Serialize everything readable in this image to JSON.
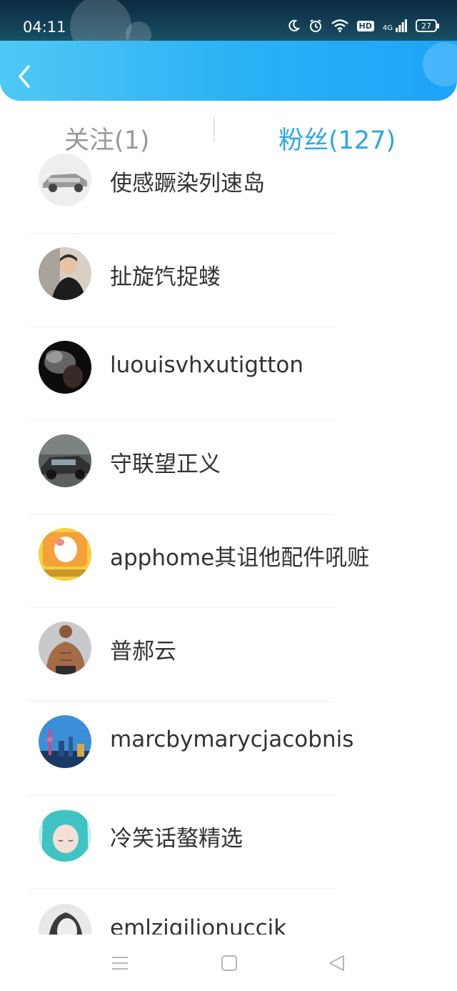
{
  "status_bar": {
    "time": "04:11",
    "icons": [
      "moon-icon",
      "alarm-icon",
      "wifi-icon",
      "hd-icon",
      "signal-4g-icon",
      "battery-icon"
    ],
    "hd_label": "HD",
    "network_label": "4G",
    "battery_level": "27"
  },
  "header": {
    "back_icon": "chevron-left-icon",
    "accent_colors": [
      "#4fc8f5",
      "#1ea4f8"
    ]
  },
  "tabs": [
    {
      "label": "关注(1)",
      "active": false
    },
    {
      "label": "粉丝(127)",
      "active": true
    }
  ],
  "tab_active_color": "#2ba8e6",
  "fans": [
    {
      "name": "使感蹶染列速岛",
      "avatar": "car-avatar"
    },
    {
      "name": "扯旋饩捉蝼",
      "avatar": "boy-avatar"
    },
    {
      "name": "luouisvhxutigtton",
      "avatar": "smoke-avatar"
    },
    {
      "name": "守联望正义",
      "avatar": "car-dark-avatar"
    },
    {
      "name": "apphome其诅他配件吼赃",
      "avatar": "cartoon-avatar"
    },
    {
      "name": "普郝云",
      "avatar": "muscle-avatar"
    },
    {
      "name": "marcbymarycjacobnis",
      "avatar": "city-avatar"
    },
    {
      "name": "冷笑话螯精选",
      "avatar": "anime-avatar"
    },
    {
      "name": "emlzigilionuccik",
      "avatar": "girl-avatar"
    }
  ],
  "nav_bar": {
    "buttons": [
      "menu-icon",
      "home-icon",
      "back-triangle-icon"
    ]
  }
}
